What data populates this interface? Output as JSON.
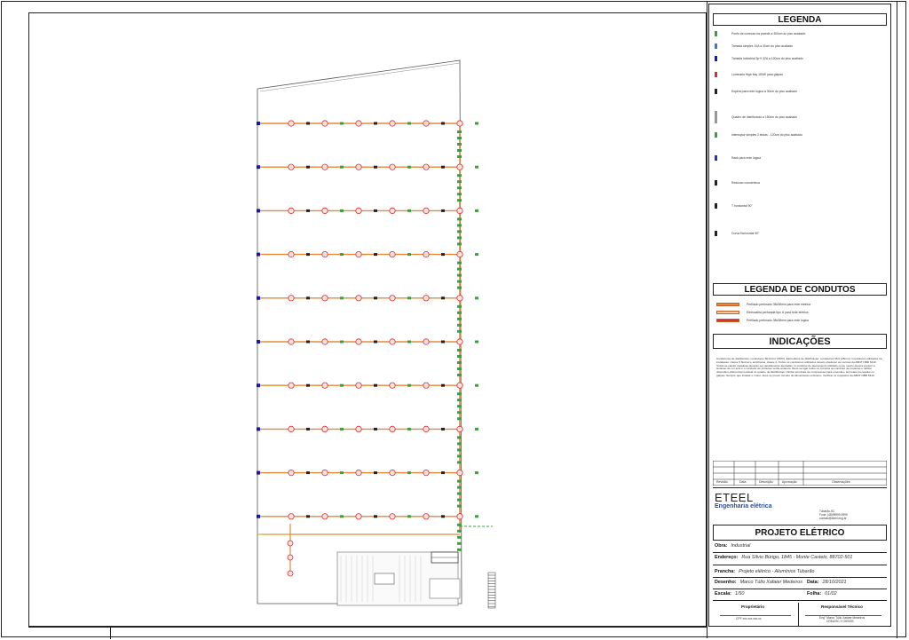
{
  "legend": {
    "title": "LEGENDA",
    "items": [
      {
        "label": "Ponto de conexao na parede a 300cm do piso acabado",
        "icon": "green-plug-icon",
        "color": "#3aa03a"
      },
      {
        "label": "Tomada simples 10A a 30cm do piso acabado",
        "icon": "outlet-icon",
        "color": "#3a7ad0"
      },
      {
        "label": "Tomada industrial 3p+t 32A a 120cm do piso acabado",
        "icon": "industrial-outlet-icon",
        "color": "#1a1aa8"
      },
      {
        "label": "Luminaria High bay 150W para galpao",
        "icon": "highbay-lamp-icon",
        "color": "#d43030"
      },
      {
        "label": "Espera para rede logica a 30cm do piso acabado",
        "icon": "network-socket-icon",
        "color": "#222222"
      },
      {
        "label": "Quadro de distribuicao a 150cm do piso acabado",
        "icon": "distribution-board-icon",
        "color": "#999999"
      },
      {
        "label": "Interruptor simples 3 teclas - 120cm do piso acabado",
        "icon": "switch-icon",
        "color": "#3aa03a"
      },
      {
        "label": "Rack para rede logica",
        "icon": "rack-icon",
        "color": "#1a3ab0"
      },
      {
        "label": "Reducao concentrica",
        "icon": "reducer-icon",
        "color": "#222222"
      },
      {
        "label": "T horizontal 90°",
        "icon": "tee-icon",
        "color": "#222222"
      },
      {
        "label": "Curva Horizontal 90°",
        "icon": "elbow-icon",
        "color": "#222222"
      }
    ]
  },
  "conduits": {
    "title": "LEGENDA DE CONDUTOS",
    "items": [
      {
        "label": "Perfilado perfurado 38x38mm para rede eletrica",
        "color": "#e08a3a"
      },
      {
        "label": "Eletrocalha perfurada tipo U para rede eletrica",
        "color": "#f2c9a0"
      },
      {
        "label": "Perfilado perfurado 38x38mm para rede logica",
        "color": "#d43030"
      }
    ]
  },
  "indications": {
    "title": "INDICAÇÕES",
    "text": "Condutores de distribuicao: condutores 60.0mm² (750V). Eletrodutos de distribuicao: condutores 95.0 (25mm). Condutores utilizados na instalacao: classe 5 flexivel e antichama, classe A. Todos os condutores utilizados devem obedecer as normas da ABNT NBR 5410. Todas as caixas metalicas deverao ser devidamente aterradas. O condutor de aterramento utilizado como neutro devera possuir a isolacao de cor azul e o condutor de protecao verde-amarelo. Deve-se ligar todos os circuitos ao condutor de protecao e utilizar dispositivo diferencial residual no quadro de distribuicao. Utilizar terminais de compressao para emenda e terminais prensados no galpao. Sempre que instalar o motor, deve-se prever circuito de alimentacao exclusivo. Verificar os requisitos da ABNT NBR 5410."
  },
  "revisions": {
    "columns": [
      "Revisão",
      "Data",
      "Descrição",
      "Aprovação",
      "Observações"
    ]
  },
  "company": {
    "name": "ETEEL",
    "subtitle": "Engenharia elétrica",
    "contact": [
      "Tubarão-SC",
      "Fone: (48)99999-9999",
      "contato@eteel.eng.br"
    ]
  },
  "project": {
    "title": "PROJETO ELÉTRICO",
    "obra_label": "Obra:",
    "obra": "Industrial",
    "endereco_label": "Endereço:",
    "endereco": "Rua Sílvio Búrigo, 1845 - Monte Castelo, 88702-501",
    "prancha_label": "Prancha:",
    "prancha": "Projeto elétrico - Alumínios Tubarão",
    "desenho_label": "Desenho:",
    "desenho": "Marco Túlio Xafaier Medeiros",
    "data_label": "Data:",
    "data": "28/10/2021",
    "escala_label": "Escala:",
    "escala": "1/50",
    "folha_label": "Folha:",
    "folha": "01/02"
  },
  "signatures": {
    "owner_label": "Proprietário",
    "owner": "CPF xxx.xxx.xxx-xx",
    "tech_label": "Responsável Técnico",
    "tech_name": "Eng° Marco Túlio Xafaier Medeiros",
    "tech_reg": "CREA/SC nº 000000"
  },
  "plan": {
    "row_count": 10,
    "lamp_color": "#d43030",
    "conduit_color": "#e08a3a",
    "green_color": "#3aa03a",
    "blue_color": "#1a1aa8"
  }
}
